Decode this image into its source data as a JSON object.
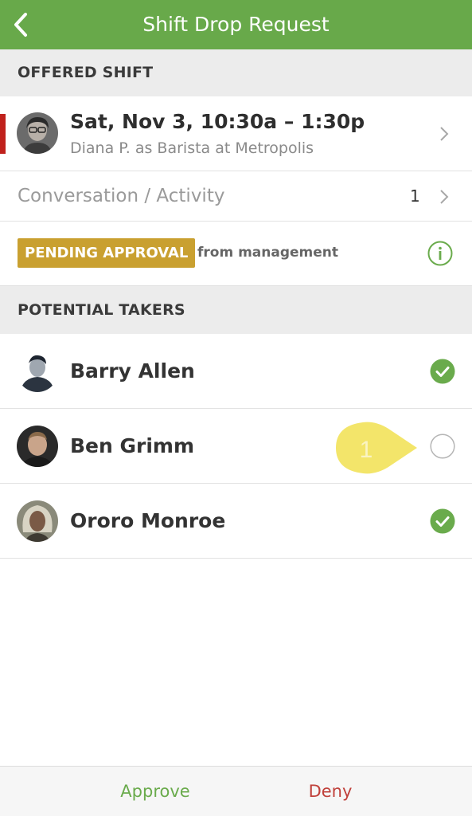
{
  "header": {
    "title": "Shift Drop Request",
    "back_icon": "chevron-left-icon",
    "background": "#68a94a"
  },
  "offered_section": {
    "label": "OFFERED SHIFT"
  },
  "shift": {
    "title": "Sat, Nov 3, 10:30a – 1:30p",
    "subtitle": "Diana P. as Barista at Metropolis",
    "indicator_color": "#c0211c"
  },
  "conversation": {
    "label": "Conversation / Activity",
    "count": "1"
  },
  "status": {
    "badge": "PENDING APPROVAL",
    "from": "from management",
    "badge_color": "#c9a030",
    "info_icon": "info-icon"
  },
  "takers_section": {
    "label": "POTENTIAL TAKERS"
  },
  "takers": [
    {
      "name": "Barry Allen",
      "selected": true
    },
    {
      "name": "Ben Grimm",
      "selected": false
    },
    {
      "name": "Ororo Monroe",
      "selected": true
    }
  ],
  "footer": {
    "approve_label": "Approve",
    "deny_label": "Deny",
    "approve_color": "#6aab4c",
    "deny_color": "#c0403a"
  },
  "overlay": {
    "tap_indicator_number": "1",
    "tap_indicator_color": "#f2e25a"
  }
}
